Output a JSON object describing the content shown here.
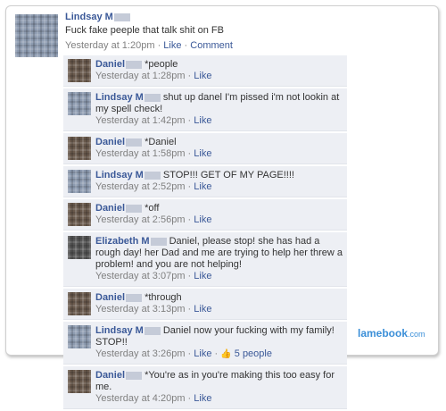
{
  "post": {
    "author": "Lindsay M",
    "text": "Fuck fake peeple that talk shit on FB",
    "time": "Yesterday at 1:20pm",
    "like": "Like",
    "comment": "Comment"
  },
  "comments": [
    {
      "author": "Daniel",
      "text": "*people",
      "time": "Yesterday at 1:28pm",
      "like": "Like",
      "avatar": "daniel"
    },
    {
      "author": "Lindsay M",
      "text": "shut up danel I'm pissed i'm not lookin at my spell check!",
      "time": "Yesterday at 1:42pm",
      "like": "Like",
      "avatar": "lindsay"
    },
    {
      "author": "Daniel",
      "text": "*Daniel",
      "time": "Yesterday at 1:58pm",
      "like": "Like",
      "avatar": "daniel"
    },
    {
      "author": "Lindsay M",
      "text": "STOP!!! GET OF MY PAGE!!!!",
      "time": "Yesterday at 2:52pm",
      "like": "Like",
      "avatar": "lindsay"
    },
    {
      "author": "Daniel",
      "text": "*off",
      "time": "Yesterday at 2:56pm",
      "like": "Like",
      "avatar": "daniel"
    },
    {
      "author": "Elizabeth M",
      "text": "Daniel, please stop! she has had a rough day! her Dad and me are trying to help her threw a problem! and you are not helping!",
      "time": "Yesterday at 3:07pm",
      "like": "Like",
      "avatar": "elizabeth"
    },
    {
      "author": "Daniel",
      "text": "*through",
      "time": "Yesterday at 3:13pm",
      "like": "Like",
      "avatar": "daniel"
    },
    {
      "author": "Lindsay M",
      "text": "Daniel now your fucking with my family! STOP!!",
      "time": "Yesterday at 3:26pm",
      "like": "Like",
      "likes_count": "5 people",
      "avatar": "lindsay"
    },
    {
      "author": "Daniel",
      "text": "*You're as in you're making this too easy for me.",
      "time": "Yesterday at 4:20pm",
      "like": "Like",
      "avatar": "daniel"
    }
  ],
  "watermark": {
    "brand": "lamebook",
    "tld": ".com"
  }
}
